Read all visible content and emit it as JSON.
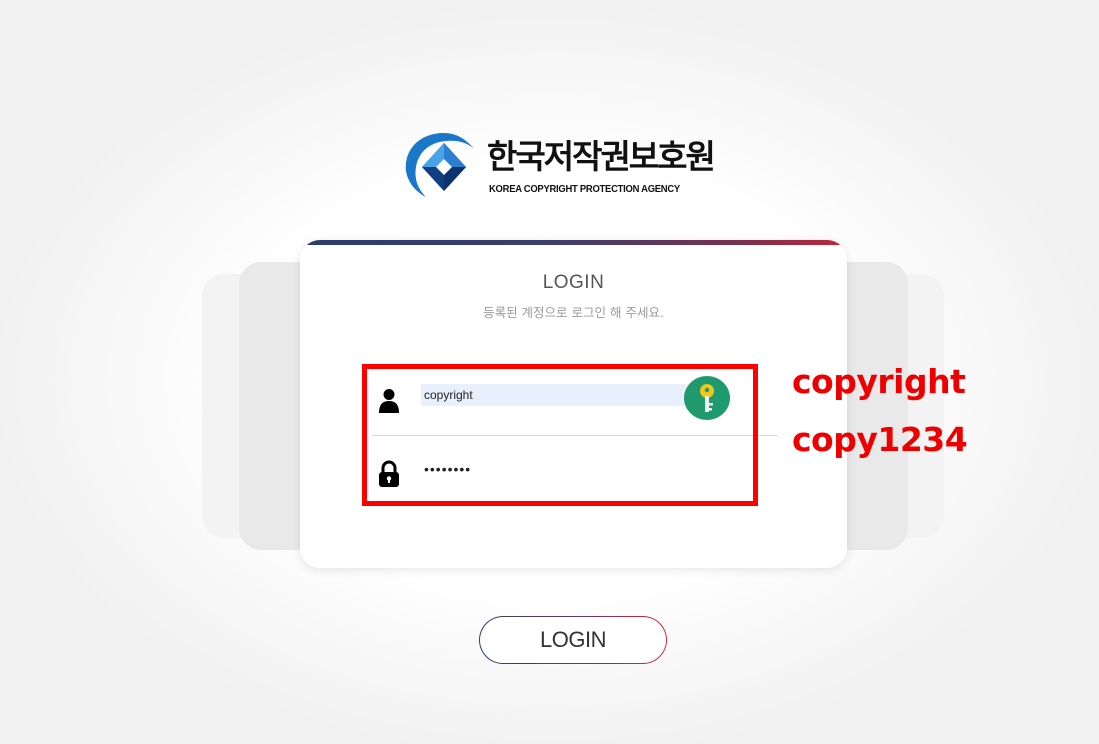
{
  "logo": {
    "title": "한국저작권보호원",
    "subtitle": "KOREA COPYRIGHT PROTECTION AGENCY",
    "emblem_icon": "kcopa-diamond-emblem"
  },
  "login_card": {
    "title": "LOGIN",
    "subtitle": "등록된 계정으로 로그인 해 주세요.",
    "username": {
      "value": "copyright",
      "icon": "user-icon"
    },
    "password": {
      "value": "copy1234",
      "icon": "lock-icon"
    },
    "key_button": {
      "icon": "key-icon"
    }
  },
  "annotation": {
    "line1": "copyright",
    "line2": "copy1234"
  },
  "login_button": {
    "label": "LOGIN"
  },
  "colors": {
    "accent_navy": "#2a3d6e",
    "accent_red": "#d02a3a",
    "key_green": "#1e9a6e",
    "annotation_red": "#ff0000",
    "autofill_blue": "#e8f0fe"
  }
}
